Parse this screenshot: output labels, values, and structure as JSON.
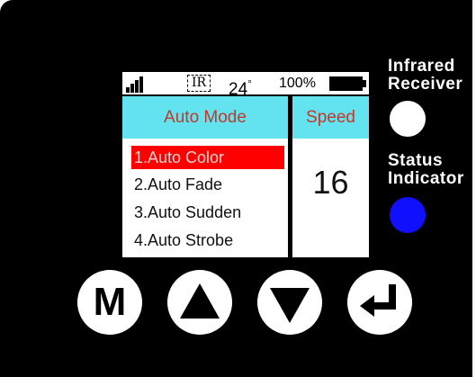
{
  "status_bar": {
    "ir_label": "IR",
    "temperature": "24",
    "degree_symbol": "°",
    "battery_percent": "100%",
    "signal_icon": "signal-bars-icon",
    "battery_icon": "battery-full-icon"
  },
  "mode_panel": {
    "header": "Auto Mode",
    "items": [
      {
        "label": "1.Auto Color",
        "selected": true
      },
      {
        "label": "2.Auto Fade",
        "selected": false
      },
      {
        "label": "3.Auto Sudden",
        "selected": false
      },
      {
        "label": "4.Auto Strobe",
        "selected": false
      }
    ]
  },
  "speed_panel": {
    "header": "Speed",
    "value": "16"
  },
  "side_labels": {
    "infrared_line1": "Infrared",
    "infrared_line2": "Receiver",
    "status_line1": "Status",
    "status_line2": "Indicator"
  },
  "buttons": {
    "menu_label": "M",
    "menu_icon": "menu-m-icon",
    "up_icon": "up-triangle-icon",
    "down_icon": "down-triangle-icon",
    "enter_icon": "enter-return-icon"
  },
  "colors": {
    "panel_background": "#000000",
    "header_background": "#63e3ef",
    "header_text": "#c0392b",
    "selected_row": "#ff0000",
    "status_indicator": "#1010ff",
    "ir_receiver": "#ffffff"
  }
}
